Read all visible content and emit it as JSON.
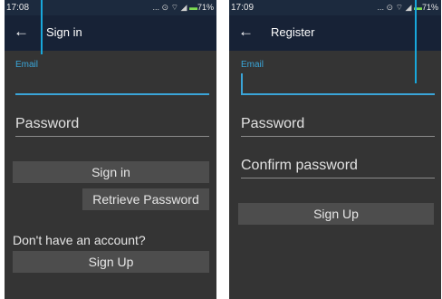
{
  "colors": {
    "accent": "#3aa5d8",
    "background": "#343434",
    "appbar": "#172236",
    "button": "#4d4d4d",
    "battery": "#7ddc52"
  },
  "signin": {
    "status": {
      "time": "17:08",
      "icons": "... ⊙ ⌔ ◢ ",
      "battery_pct": "71%"
    },
    "appbar": {
      "back_icon": "←",
      "title": "Sign in"
    },
    "email_label": "Email",
    "password_placeholder": "Password",
    "signin_button": "Sign in",
    "retrieve_button": "Retrieve Password",
    "no_account_text": "Don't have an account?",
    "signup_button": "Sign Up"
  },
  "register": {
    "status": {
      "time": "17:09",
      "icons": "... ⊙ ⌔ ◢ ",
      "battery_pct": "71%"
    },
    "appbar": {
      "back_icon": "←",
      "title": "Register"
    },
    "email_label": "Email",
    "password_placeholder": "Password",
    "confirm_placeholder": "Confirm password",
    "signup_button": "Sign Up"
  }
}
